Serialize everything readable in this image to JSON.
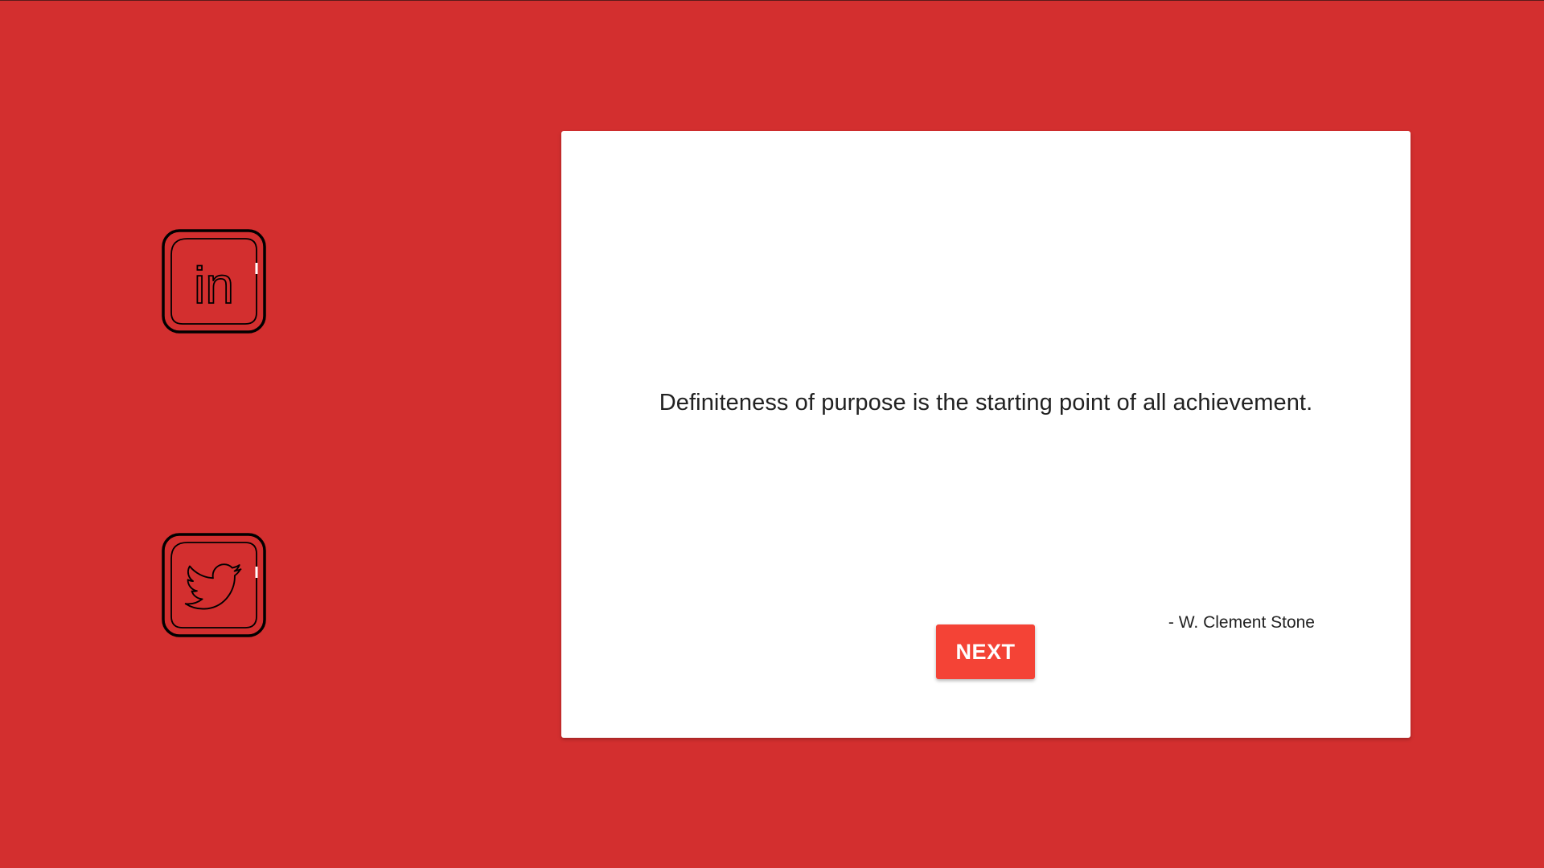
{
  "theme": {
    "background": "#d32f2f",
    "card_background": "#ffffff",
    "button_color": "#f44336",
    "icon_stroke": "#000000"
  },
  "social": {
    "linkedin": {
      "icon": "linkedin-icon",
      "label": "in"
    },
    "twitter": {
      "icon": "twitter-icon"
    }
  },
  "quote": {
    "text": "Definiteness of purpose is the starting point of all achievement.",
    "author": "- W. Clement Stone"
  },
  "actions": {
    "next_label": "NEXT"
  }
}
